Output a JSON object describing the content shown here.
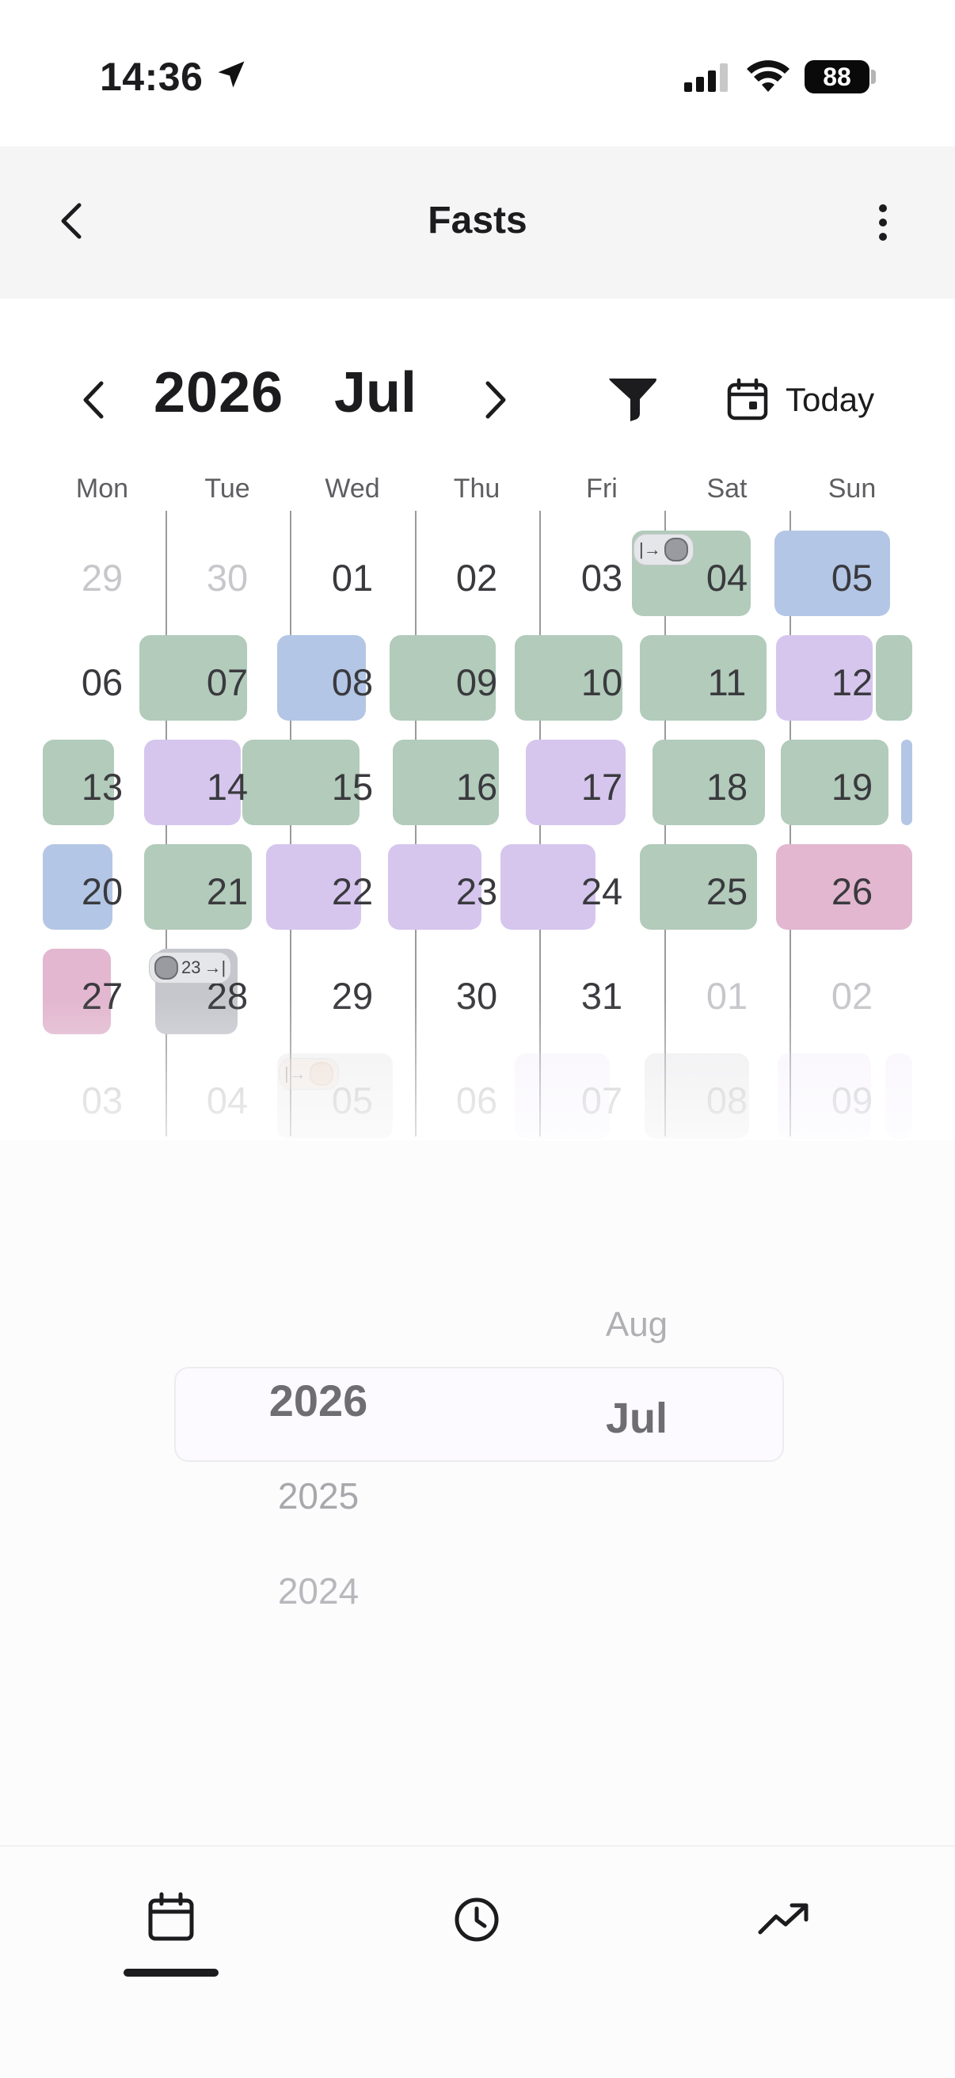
{
  "status_bar": {
    "time": "14:36",
    "battery": "88"
  },
  "nav": {
    "title": "Fasts"
  },
  "header": {
    "year": "2026",
    "month": "Jul",
    "today_label": "Today"
  },
  "weekdays": [
    "Mon",
    "Tue",
    "Wed",
    "Thu",
    "Fri",
    "Sat",
    "Sun"
  ],
  "weeks": [
    [
      "29",
      "30",
      "01",
      "02",
      "03",
      "04",
      "05"
    ],
    [
      "06",
      "07",
      "08",
      "09",
      "10",
      "11",
      "12"
    ],
    [
      "13",
      "14",
      "15",
      "16",
      "17",
      "18",
      "19"
    ],
    [
      "20",
      "21",
      "22",
      "23",
      "24",
      "25",
      "26"
    ],
    [
      "27",
      "28",
      "29",
      "30",
      "31",
      "01",
      "02"
    ],
    [
      "03",
      "04",
      "05",
      "06",
      "07",
      "08",
      "09"
    ]
  ],
  "pill_duration": "23",
  "colors": {
    "green": "#b2cbbb",
    "blue": "#b3c6e6",
    "purple": "#d6c6ee",
    "pink": "#e2b7cf",
    "gray": "#c6c7cd",
    "accent": "#1c1c1e"
  },
  "picker": {
    "years": [
      "2026",
      "2025",
      "2024"
    ],
    "months": [
      "Aug",
      "Jul"
    ],
    "selected_year": "2026",
    "selected_month": "Jul"
  },
  "tabs": [
    "calendar-icon",
    "clock-icon",
    "trend-icon"
  ]
}
